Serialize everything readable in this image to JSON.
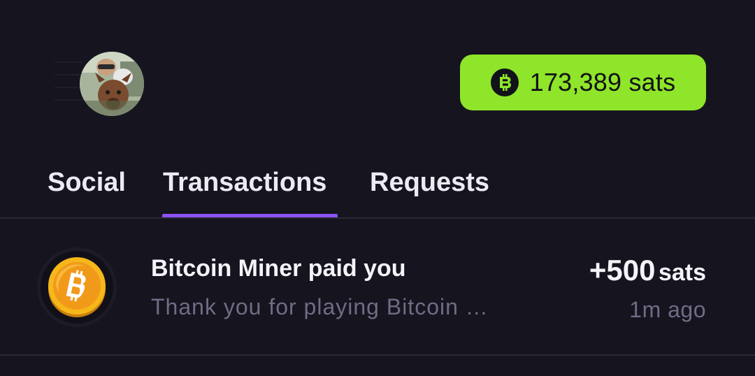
{
  "header": {
    "avatar_icon": "user-avatar-photo",
    "balance": {
      "icon": "bitcoin-coin-icon",
      "value": "173,389 sats",
      "background_color": "#8ee52a"
    }
  },
  "tabs": [
    {
      "label": "Social",
      "active": false
    },
    {
      "label": "Transactions",
      "active": true
    },
    {
      "label": "Requests",
      "active": false
    }
  ],
  "accent_color": "#8c52f2",
  "transactions": [
    {
      "icon": "bitcoin-gold-coin-icon",
      "title": "Bitcoin Miner paid you",
      "subtitle": "Thank you for playing Bitcoin Miner!",
      "amount_value": "+500",
      "amount_unit": "sats",
      "time": "1m ago"
    }
  ]
}
